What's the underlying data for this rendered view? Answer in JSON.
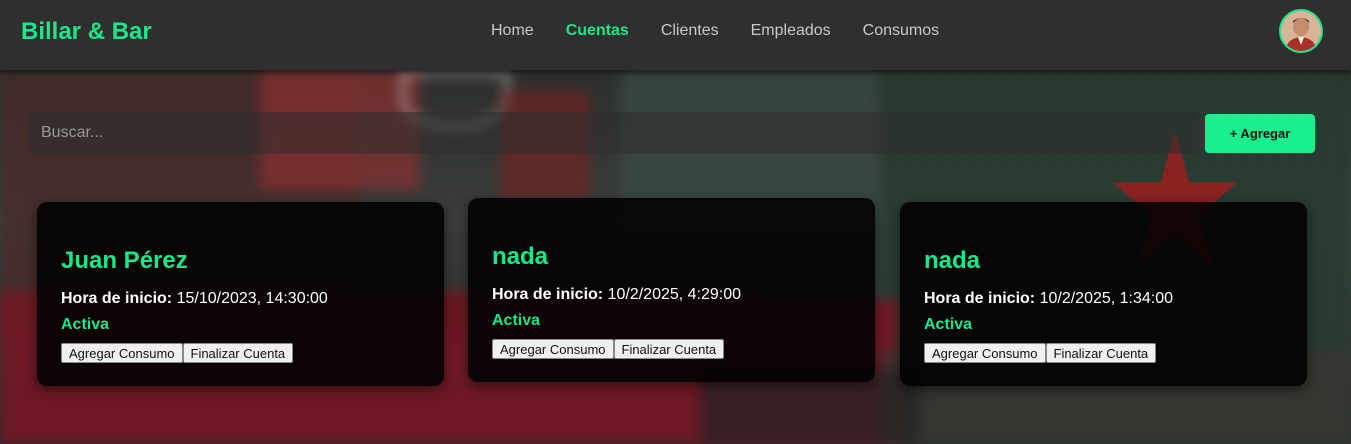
{
  "navbar": {
    "brand": "Billar & Bar",
    "links": [
      {
        "label": "Home",
        "active": false
      },
      {
        "label": "Cuentas",
        "active": true
      },
      {
        "label": "Clientes",
        "active": false
      },
      {
        "label": "Empleados",
        "active": false
      },
      {
        "label": "Consumos",
        "active": false
      }
    ]
  },
  "toolbar": {
    "search_placeholder": "Buscar...",
    "add_label": "+ Agregar"
  },
  "cards": [
    {
      "name": "Juan Pérez",
      "time_label": "Hora de inicio:",
      "time_value": "15/10/2023, 14:30:00",
      "status": "Activa",
      "btn_consumo": "Agregar Consumo",
      "btn_finalizar": "Finalizar Cuenta"
    },
    {
      "name": "nada",
      "time_label": "Hora de inicio:",
      "time_value": "10/2/2025, 4:29:00",
      "status": "Activa",
      "btn_consumo": "Agregar Consumo",
      "btn_finalizar": "Finalizar Cuenta"
    },
    {
      "name": "nada",
      "time_label": "Hora de inicio:",
      "time_value": "10/2/2025, 1:34:00",
      "status": "Activa",
      "btn_consumo": "Agregar Consumo",
      "btn_finalizar": "Finalizar Cuenta"
    }
  ],
  "colors": {
    "accent": "#18e88a",
    "navbar_bg": "#2f2f2f",
    "card_bg": "#000000"
  }
}
